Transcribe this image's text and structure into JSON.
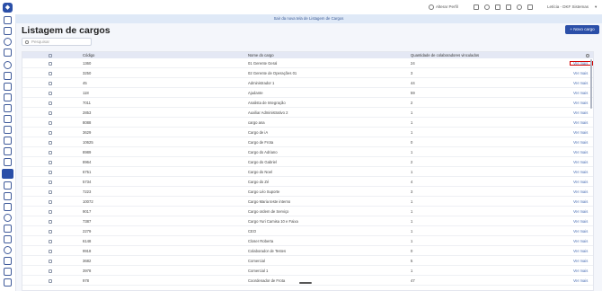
{
  "topbar": {
    "switch_profile": "Alterar Perfil",
    "user": "Letícia - DKF Sistemas"
  },
  "banner": "Sair da nova tela de Listagem de Cargos",
  "page": {
    "title": "Listagem de cargos",
    "new_button": "+ Novo cargo",
    "search_placeholder": "Pesquisar"
  },
  "table": {
    "columns": [
      "Código",
      "Nome do cargo",
      "Quantidade de colaboradores vinculados"
    ],
    "action_label": "Ver mais",
    "rows": [
      {
        "code": "1360",
        "name": "01 Gerente Geral",
        "qty": "24"
      },
      {
        "code": "3250",
        "name": "02 Gerente de Operações 01",
        "qty": "3"
      },
      {
        "code": "45",
        "name": "Administrador 1",
        "qty": "44"
      },
      {
        "code": "118",
        "name": "Ajudante",
        "qty": "59"
      },
      {
        "code": "7011",
        "name": "Analista de Integração",
        "qty": "2"
      },
      {
        "code": "2853",
        "name": "Auxiliar Administrativo 2",
        "qty": "1"
      },
      {
        "code": "8088",
        "name": "cargo ana",
        "qty": "1"
      },
      {
        "code": "3629",
        "name": "Cargo de iA",
        "qty": "1"
      },
      {
        "code": "10625",
        "name": "Cargo de Frota",
        "qty": "0"
      },
      {
        "code": "8989",
        "name": "Cargo do Adriano",
        "qty": "1"
      },
      {
        "code": "8964",
        "name": "Cargo do Gabriel",
        "qty": "2"
      },
      {
        "code": "6751",
        "name": "Cargo do Noel",
        "qty": "1"
      },
      {
        "code": "5734",
        "name": "Cargo do Zé",
        "qty": "4"
      },
      {
        "code": "7223",
        "name": "Cargo Léo Suporte",
        "qty": "3"
      },
      {
        "code": "10072",
        "name": "Cargo Maria teste interno",
        "qty": "1"
      },
      {
        "code": "9017",
        "name": "Cargo ordem de Serviço",
        "qty": "1"
      },
      {
        "code": "7387",
        "name": "Cargo Yuri Camisa 10 e Faixa",
        "qty": "1"
      },
      {
        "code": "2279",
        "name": "CEO",
        "qty": "1"
      },
      {
        "code": "6148",
        "name": "Closer Roberta",
        "qty": "1"
      },
      {
        "code": "9918",
        "name": "Colaborador de Testes",
        "qty": "0"
      },
      {
        "code": "3682",
        "name": "Comercial",
        "qty": "5"
      },
      {
        "code": "3978",
        "name": "Comercial 1",
        "qty": "1"
      },
      {
        "code": "978",
        "name": "Coordenador de Frota",
        "qty": "47"
      }
    ]
  }
}
